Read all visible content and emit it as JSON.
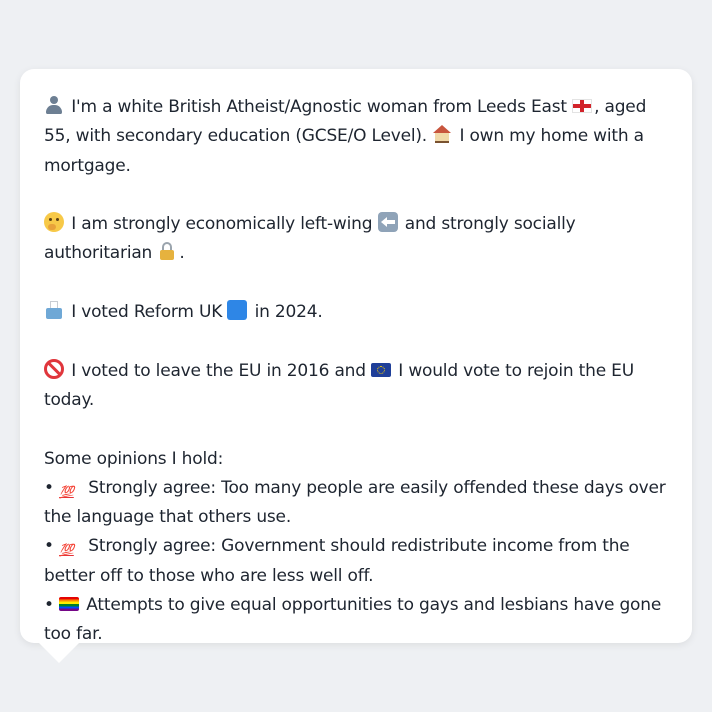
{
  "profile": {
    "intro": {
      "part1": "I'm a white British Atheist/Agnostic woman from Leeds East",
      "part2": ", aged 55, with secondary education (GCSE/O Level).",
      "part3": "I own my home with a mortgage."
    },
    "politics": {
      "part1": "I am strongly economically left-wing",
      "part2": "and strongly socially authoritarian",
      "part3": "."
    },
    "vote": {
      "part1": "I voted Reform UK",
      "part2": "in 2024."
    },
    "eu": {
      "part1": "I voted to leave the EU in 2016 and",
      "part2": "I would vote to rejoin the EU today."
    },
    "opinions_heading": "Some opinions I hold:",
    "opinions": [
      {
        "bullet": "•",
        "emoji_text": "💯",
        "text": "Strongly agree: Too many people are easily offended these days over the language that others use."
      },
      {
        "bullet": "•",
        "emoji_text": "💯",
        "text": "Strongly agree: Government should redistribute income from the better off to those who are less well off."
      },
      {
        "bullet": "•",
        "text": "Attempts to give equal opportunities to gays and lesbians have gone too far."
      }
    ]
  },
  "icons": {
    "intro": [
      "person-icon",
      "england-flag-icon",
      "house-icon"
    ],
    "politics": [
      "thinking-face-icon",
      "left-arrow-icon",
      "lock-icon"
    ],
    "vote": [
      "ballot-box-icon",
      "blue-square-icon"
    ],
    "eu": [
      "prohibited-icon",
      "eu-flag-icon"
    ],
    "opinions": [
      "hundred-points-icon",
      "hundred-points-icon",
      "rainbow-flag-icon"
    ]
  },
  "colors": {
    "background": "#eef0f3",
    "card": "#ffffff",
    "text": "#1e2530"
  }
}
